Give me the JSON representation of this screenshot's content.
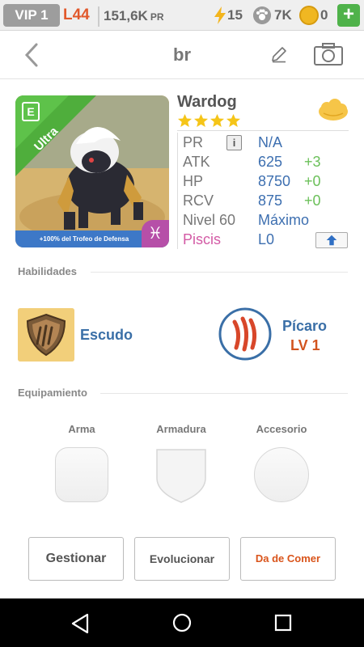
{
  "status_bar": {
    "vip": "VIP 1",
    "level": "L44",
    "pr_total": "151,6K",
    "pr_unit": "PR",
    "energy": "15",
    "food": "7K",
    "coins": "0",
    "add_label": "+"
  },
  "header": {
    "title": "br"
  },
  "pet": {
    "name": "Wardog",
    "stars": 4,
    "rarity_label": "Ultra",
    "card_badge": "E",
    "card_footer": "+100% del Trofeo de Defensa",
    "zodiac_symbol": "♓",
    "stats": {
      "pr_label": "PR",
      "pr_value": "N/A",
      "atk_label": "ATK",
      "atk_value": "625",
      "atk_bonus": "+3",
      "hp_label": "HP",
      "hp_value": "8750",
      "hp_bonus": "+0",
      "rcv_label": "RCV",
      "rcv_value": "875",
      "rcv_bonus": "+0",
      "level_label": "Nivel 60",
      "level_value": "Máximo",
      "sign_label": "Piscis",
      "sign_value": "L0"
    }
  },
  "abilities": {
    "title": "Habilidades",
    "skill_name": "Escudo",
    "class_name": "Pícaro",
    "class_level": "LV 1"
  },
  "equipment": {
    "title": "Equipamiento",
    "weapon": "Arma",
    "armor": "Armadura",
    "accessory": "Accesorio"
  },
  "actions": {
    "manage": "Gestionar",
    "evolve": "Evolucionar",
    "feed": "Da de Comer"
  },
  "colors": {
    "accent_blue": "#3a6fa7",
    "accent_orange": "#d2541f",
    "bonus_green": "#6bc05a",
    "star_yellow": "#f5c518",
    "ultra_green": "#4fae3c",
    "card_blue": "#3d78c7"
  }
}
